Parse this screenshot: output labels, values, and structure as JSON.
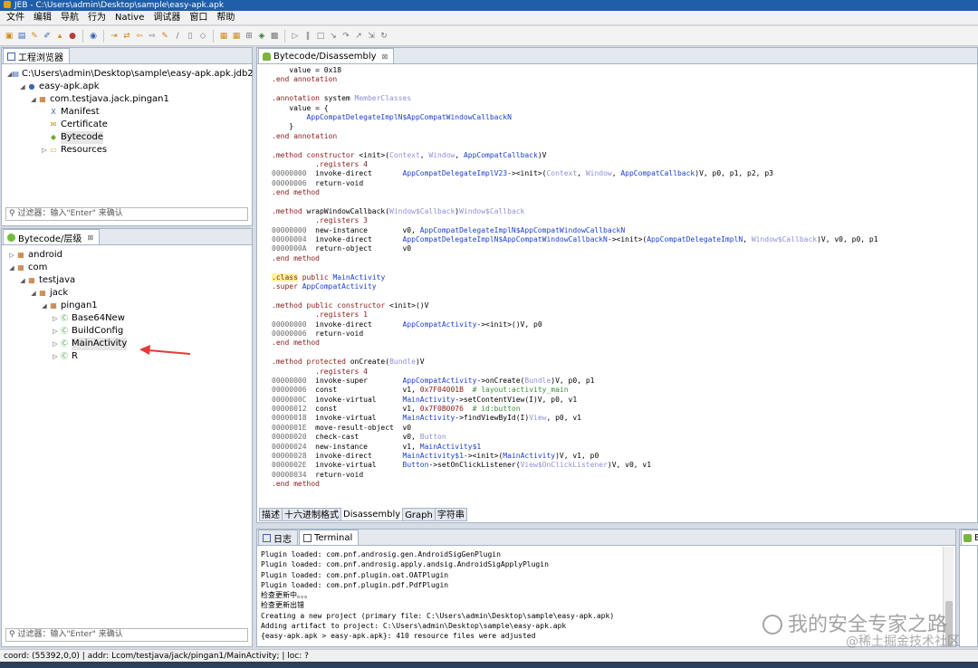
{
  "window": {
    "title": "JEB - C:\\Users\\admin\\Desktop\\sample\\easy-apk.apk"
  },
  "menu": [
    "文件",
    "编辑",
    "导航",
    "行为",
    "Native",
    "调试器",
    "窗口",
    "帮助"
  ],
  "project_explorer": {
    "tab": "工程浏览器",
    "filter_placeholder": "过滤器：输入\"Enter\" 来确认",
    "nodes": [
      {
        "label": "C:\\Users\\admin\\Desktop\\sample\\easy-apk.apk.jdb2",
        "level": 0,
        "expanded": true,
        "icon": "database-icon"
      },
      {
        "label": "easy-apk.apk",
        "level": 1,
        "expanded": true,
        "icon": "apk-icon"
      },
      {
        "label": "com.testjava.jack.pingan1",
        "level": 2,
        "expanded": true,
        "icon": "package-icon"
      },
      {
        "label": "Manifest",
        "level": 3,
        "icon": "manifest-icon"
      },
      {
        "label": "Certificate",
        "level": 3,
        "icon": "certificate-icon"
      },
      {
        "label": "Bytecode",
        "level": 3,
        "icon": "android-icon",
        "selected": true
      },
      {
        "label": "Resources",
        "level": 3,
        "expanded": false,
        "icon": "folder-icon"
      }
    ]
  },
  "hierarchy": {
    "tab": "Bytecode/层级",
    "filter_placeholder": "过滤器：输入\"Enter\" 来确认",
    "nodes": [
      {
        "label": "android",
        "level": 0,
        "expanded": false,
        "icon": "package-icon"
      },
      {
        "label": "com",
        "level": 0,
        "expanded": true,
        "icon": "package-icon"
      },
      {
        "label": "testjava",
        "level": 1,
        "expanded": true,
        "icon": "package-icon"
      },
      {
        "label": "jack",
        "level": 2,
        "expanded": true,
        "icon": "package-icon"
      },
      {
        "label": "pingan1",
        "level": 3,
        "expanded": true,
        "icon": "package-icon"
      },
      {
        "label": "Base64New",
        "level": 4,
        "expanded": false,
        "icon": "class-icon"
      },
      {
        "label": "BuildConfig",
        "level": 4,
        "expanded": false,
        "icon": "class-icon"
      },
      {
        "label": "MainActivity",
        "level": 4,
        "expanded": false,
        "icon": "class-icon",
        "selected": true
      },
      {
        "label": "R",
        "level": 4,
        "expanded": false,
        "icon": "class-icon"
      }
    ]
  },
  "editor": {
    "tab": "Bytecode/Disassembly",
    "lines": [
      [
        [
          "    value = 0x18",
          ""
        ]
      ],
      [
        [
          ".end annotation",
          "kw"
        ]
      ],
      [
        [
          "",
          ""
        ]
      ],
      [
        [
          ".annotation",
          "kw"
        ],
        [
          " system ",
          ""
        ],
        [
          "MemberClasses",
          "tyl"
        ]
      ],
      [
        [
          "    value = {",
          ""
        ]
      ],
      [
        [
          "        ",
          ""
        ],
        [
          "AppCompatDelegateImplN$AppCompatWindowCallbackN",
          "ty"
        ]
      ],
      [
        [
          "    }",
          ""
        ]
      ],
      [
        [
          ".end annotation",
          "kw"
        ]
      ],
      [
        [
          "",
          ""
        ]
      ],
      [
        [
          ".method",
          "kw"
        ],
        [
          " constructor ",
          "kw"
        ],
        [
          "<init>(",
          ""
        ],
        [
          "Context",
          "tyl"
        ],
        [
          ", ",
          ""
        ],
        [
          "Window",
          "tyl"
        ],
        [
          ", ",
          ""
        ],
        [
          "AppCompatCallback",
          "ty"
        ],
        [
          ")V",
          ""
        ]
      ],
      [
        [
          "          .registers 4",
          "kw"
        ]
      ],
      [
        [
          "00000000",
          "ad"
        ],
        [
          "  invoke-direct       ",
          ""
        ],
        [
          "AppCompatDelegateImplV23",
          "ty"
        ],
        [
          "-><init>(",
          ""
        ],
        [
          "Context",
          "tyl"
        ],
        [
          ", ",
          ""
        ],
        [
          "Window",
          "tyl"
        ],
        [
          ", ",
          ""
        ],
        [
          "AppCompatCallback",
          "ty"
        ],
        [
          ")V, p0, p1, p2, p3",
          ""
        ]
      ],
      [
        [
          "00000006",
          "ad"
        ],
        [
          "  return-void",
          ""
        ]
      ],
      [
        [
          ".end method",
          "kw"
        ]
      ],
      [
        [
          "",
          ""
        ]
      ],
      [
        [
          ".method",
          "kw"
        ],
        [
          " wrapWindowCallback(",
          ""
        ],
        [
          "Window$Callback",
          "tyl"
        ],
        [
          ")",
          ""
        ],
        [
          "Window$Callback",
          "tyl"
        ]
      ],
      [
        [
          "          .registers 3",
          "kw"
        ]
      ],
      [
        [
          "00000000",
          "ad"
        ],
        [
          "  new-instance        v0, ",
          ""
        ],
        [
          "AppCompatDelegateImplN$AppCompatWindowCallbackN",
          "ty"
        ]
      ],
      [
        [
          "00000004",
          "ad"
        ],
        [
          "  invoke-direct       ",
          ""
        ],
        [
          "AppCompatDelegateImplN$AppCompatWindowCallbackN",
          "ty"
        ],
        [
          "-><init>(",
          ""
        ],
        [
          "AppCompatDelegateImplN",
          "ty"
        ],
        [
          ", ",
          ""
        ],
        [
          "Window$Callback",
          "tyl"
        ],
        [
          ")V, v0, p0, p1",
          ""
        ]
      ],
      [
        [
          "0000000A",
          "ad"
        ],
        [
          "  return-object       v0",
          ""
        ]
      ],
      [
        [
          ".end method",
          "kw"
        ]
      ],
      [
        [
          "",
          ""
        ]
      ],
      [
        [
          ".class",
          "kw hl"
        ],
        [
          " ",
          ""
        ],
        [
          "public",
          "kw"
        ],
        [
          " ",
          ""
        ],
        [
          "MainActivity",
          "ty"
        ]
      ],
      [
        [
          ".super",
          "kw"
        ],
        [
          " ",
          ""
        ],
        [
          "AppCompatActivity",
          "ty"
        ]
      ],
      [
        [
          "",
          ""
        ]
      ],
      [
        [
          ".method",
          "kw"
        ],
        [
          " public constructor ",
          "kw"
        ],
        [
          "<init>()V",
          ""
        ]
      ],
      [
        [
          "          .registers 1",
          "kw"
        ]
      ],
      [
        [
          "00000000",
          "ad"
        ],
        [
          "  invoke-direct       ",
          ""
        ],
        [
          "AppCompatActivity",
          "ty"
        ],
        [
          "-><init>()V, p0",
          ""
        ]
      ],
      [
        [
          "00000006",
          "ad"
        ],
        [
          "  return-void",
          ""
        ]
      ],
      [
        [
          ".end method",
          "kw"
        ]
      ],
      [
        [
          "",
          ""
        ]
      ],
      [
        [
          ".method",
          "kw"
        ],
        [
          " protected ",
          "kw"
        ],
        [
          "onCreate(",
          ""
        ],
        [
          "Bundle",
          "tyl"
        ],
        [
          ")V",
          ""
        ]
      ],
      [
        [
          "          .registers 4",
          "kw"
        ]
      ],
      [
        [
          "00000000",
          "ad"
        ],
        [
          "  invoke-super        ",
          ""
        ],
        [
          "AppCompatActivity",
          "ty"
        ],
        [
          "->onCreate(",
          ""
        ],
        [
          "Bundle",
          "tyl"
        ],
        [
          ")V, p0, p1",
          ""
        ]
      ],
      [
        [
          "00000006",
          "ad"
        ],
        [
          "  const               v1, ",
          ""
        ],
        [
          "0x7F04001B",
          "kw"
        ],
        [
          "  ",
          ""
        ],
        [
          "# layout:activity_main",
          "cm"
        ]
      ],
      [
        [
          "0000000C",
          "ad"
        ],
        [
          "  invoke-virtual      ",
          ""
        ],
        [
          "MainActivity",
          "ty"
        ],
        [
          "->setContentView(I)V, p0, v1",
          ""
        ]
      ],
      [
        [
          "00000012",
          "ad"
        ],
        [
          "  const               v1, ",
          ""
        ],
        [
          "0x7F0B0076",
          "kw"
        ],
        [
          "  ",
          ""
        ],
        [
          "# id:button",
          "cm"
        ]
      ],
      [
        [
          "00000018",
          "ad"
        ],
        [
          "  invoke-virtual      ",
          ""
        ],
        [
          "MainActivity",
          "ty"
        ],
        [
          "->findViewById(I)",
          ""
        ],
        [
          "View",
          "tyl"
        ],
        [
          ", p0, v1",
          ""
        ]
      ],
      [
        [
          "0000001E",
          "ad"
        ],
        [
          "  move-result-object  v0",
          ""
        ]
      ],
      [
        [
          "00000020",
          "ad"
        ],
        [
          "  check-cast          v0, ",
          ""
        ],
        [
          "Button",
          "tyl"
        ]
      ],
      [
        [
          "00000024",
          "ad"
        ],
        [
          "  new-instance        v1, ",
          ""
        ],
        [
          "MainActivity$1",
          "ty"
        ]
      ],
      [
        [
          "00000028",
          "ad"
        ],
        [
          "  invoke-direct       ",
          ""
        ],
        [
          "MainActivity$1",
          "ty"
        ],
        [
          "-><init>(",
          ""
        ],
        [
          "MainActivity",
          "ty"
        ],
        [
          ")V, v1, p0",
          ""
        ]
      ],
      [
        [
          "0000002E",
          "ad"
        ],
        [
          "  invoke-virtual      ",
          ""
        ],
        [
          "Button",
          "ty"
        ],
        [
          "->setOnClickListener(",
          ""
        ],
        [
          "View$OnClickListener",
          "tyl"
        ],
        [
          ")V, v0, v1",
          ""
        ]
      ],
      [
        [
          "00000034",
          "ad"
        ],
        [
          "  return-void",
          ""
        ]
      ],
      [
        [
          ".end method",
          "kw"
        ]
      ]
    ]
  },
  "editor_tabs": [
    "描述",
    "十六进制格式",
    "Disassembly",
    "Graph",
    "字符串"
  ],
  "console": {
    "tabs": [
      "日志",
      "Terminal"
    ],
    "lines": [
      "Plugin loaded: com.pnf.androsig.gen.AndroidSigGenPlugin",
      "Plugin loaded: com.pnf.androsig.apply.andsig.AndroidSigApplyPlugin",
      "Plugin loaded: com.pnf.plugin.oat.OATPlugin",
      "Plugin loaded: com.pnf.plugin.pdf.PdfPlugin",
      "检查更新中。。。",
      "检查更新出错",
      "Creating a new project (primary file: C:\\Users\\admin\\Desktop\\sample\\easy-apk.apk)",
      "Adding artifact to project: C:\\Users\\admin\\Desktop\\sample\\easy-apk.apk",
      "{easy-apk.apk > easy-apk.apk}: 410 resource files were adjusted"
    ]
  },
  "right_collapsed_tab": "By",
  "status": "coord: (55392,0,0) | addr: Lcom/testjava/jack/pingan1/MainActivity; | loc: ?",
  "watermark": {
    "line1": "我的安全专家之路",
    "line2": "@稀土掘金技术社区"
  },
  "colors": {
    "titlebar": "#1f5ea8",
    "annotation_arrow": "#e53935",
    "keyword": "#8b1a1a",
    "type": "#1c3fc9"
  }
}
